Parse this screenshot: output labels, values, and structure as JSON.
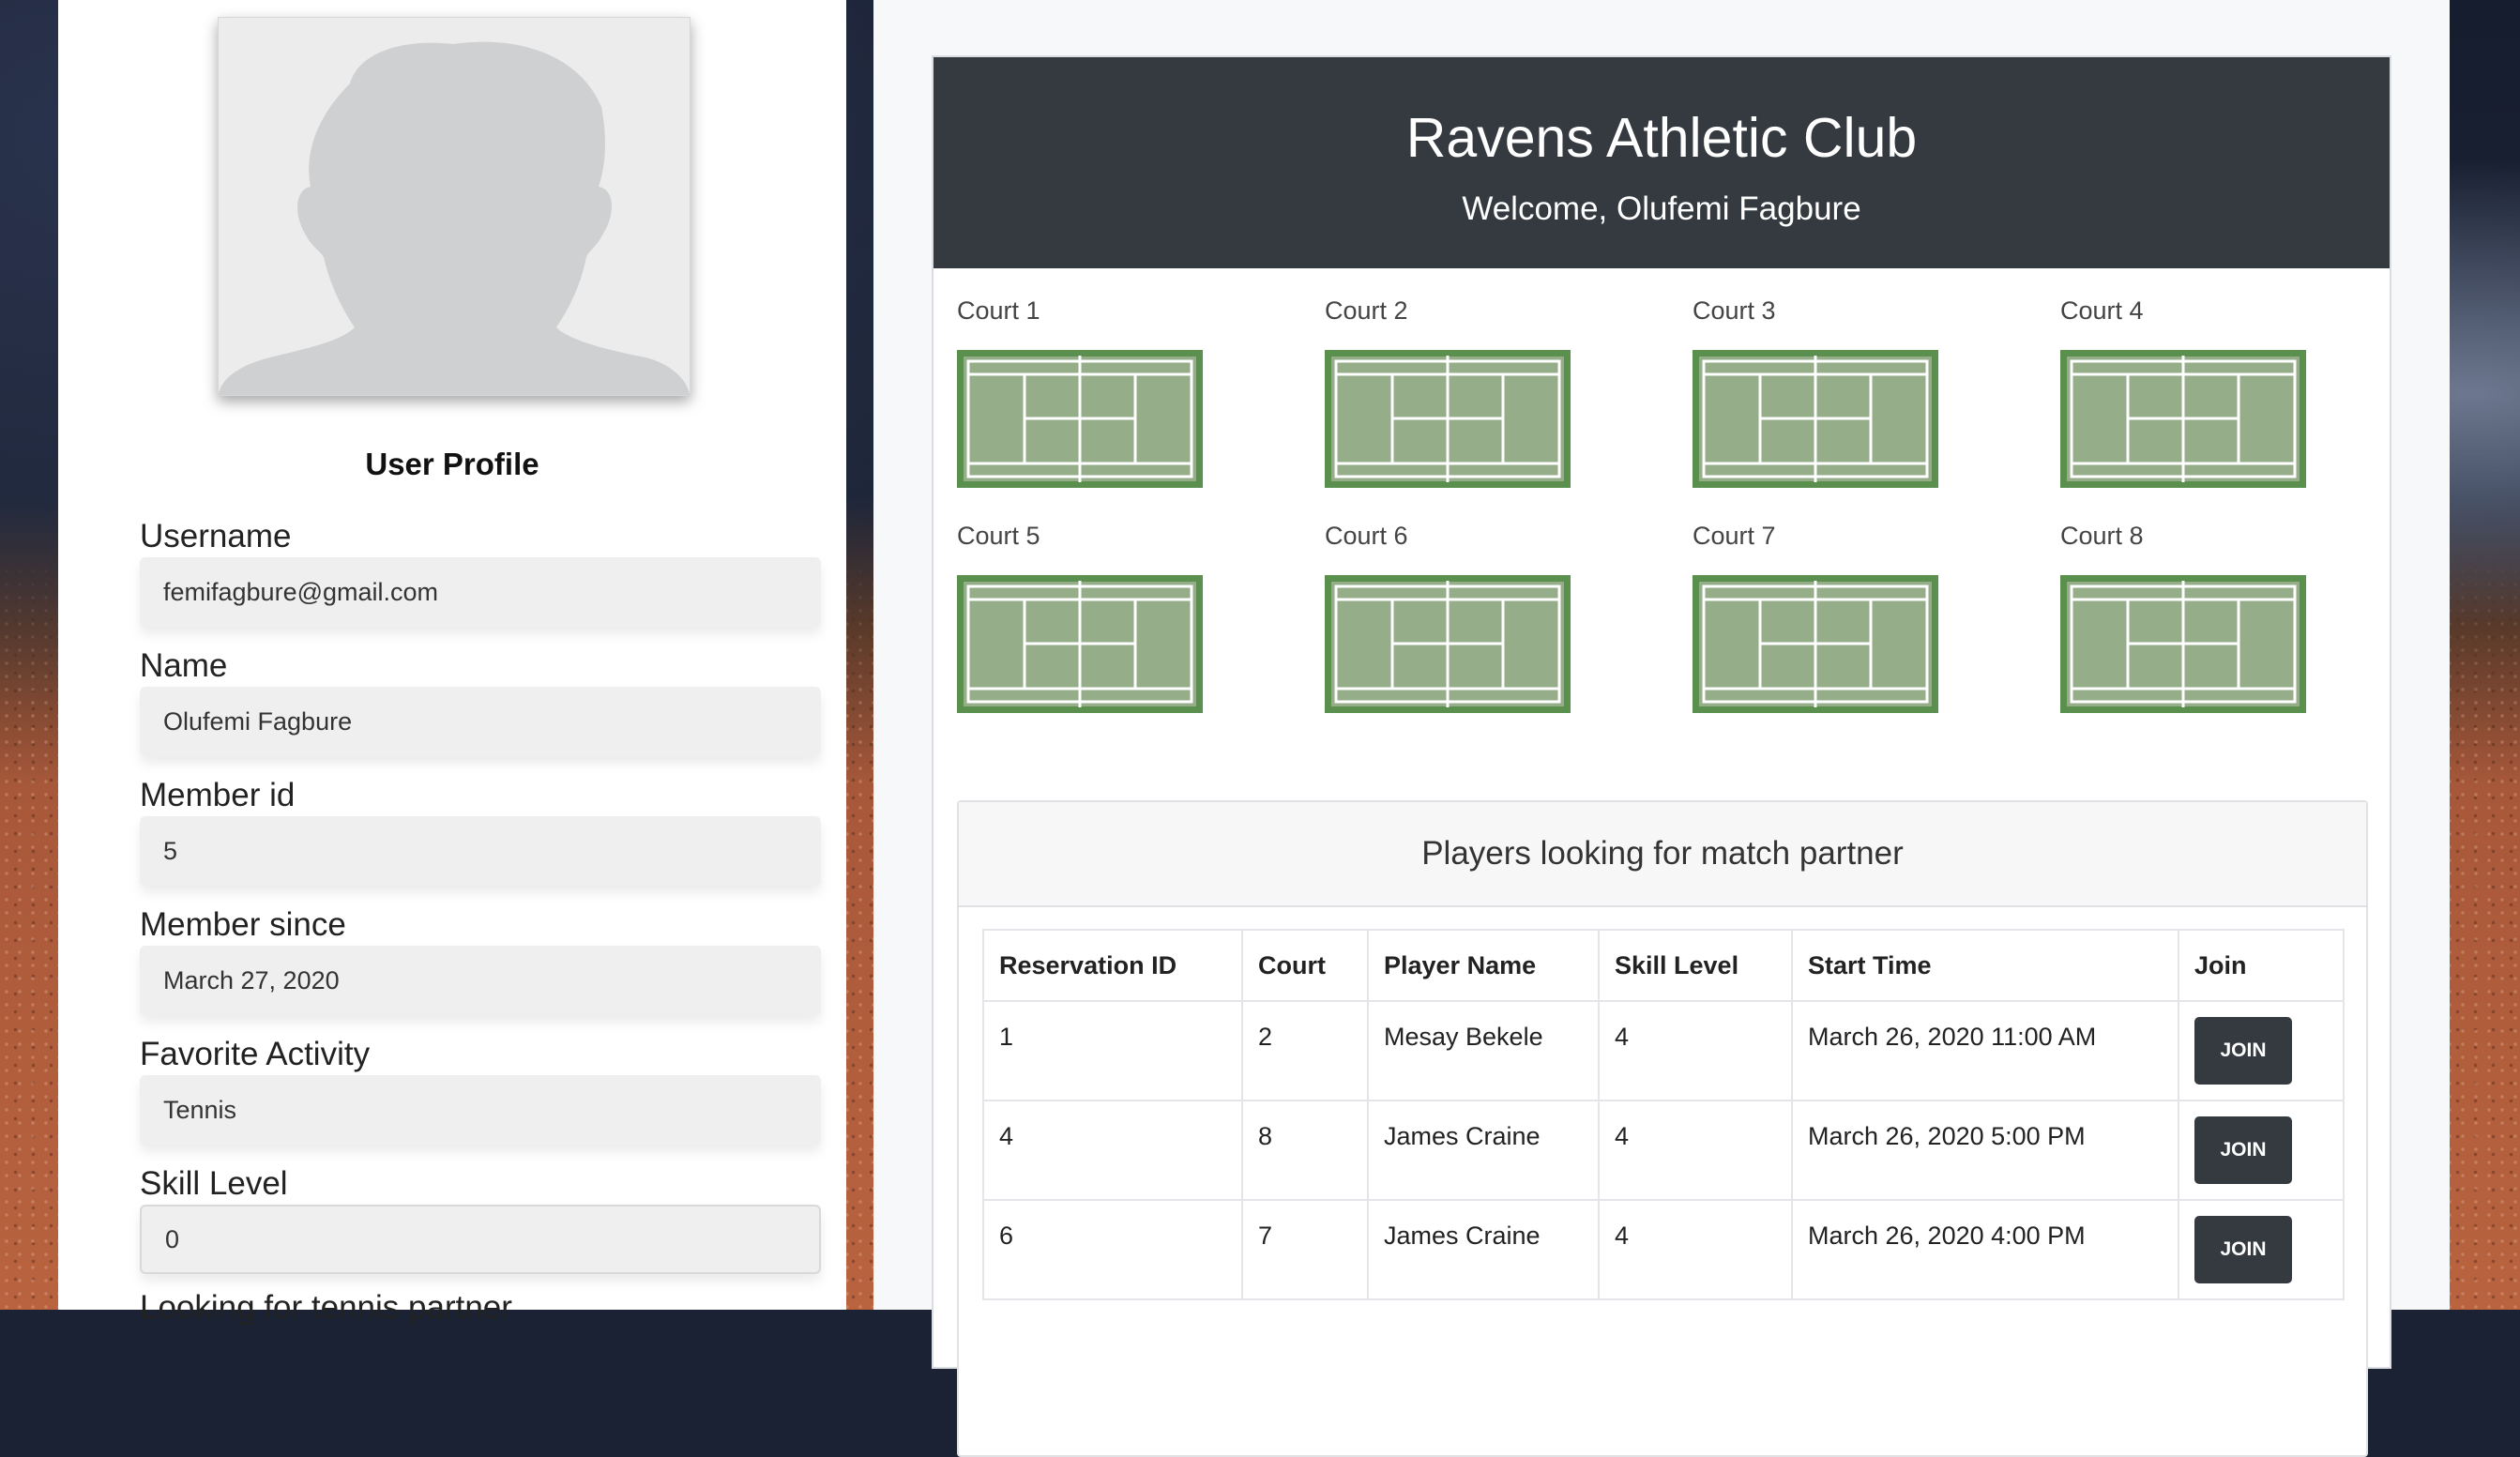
{
  "profile": {
    "title": "User Profile",
    "fields": [
      {
        "label": "Username",
        "value": "femifagbure@gmail.com"
      },
      {
        "label": "Name",
        "value": "Olufemi Fagbure"
      },
      {
        "label": "Member id",
        "value": "5"
      },
      {
        "label": "Member since",
        "value": "March 27, 2020"
      },
      {
        "label": "Favorite Activity",
        "value": "Tennis"
      },
      {
        "label": "Skill Level",
        "value": "0"
      }
    ],
    "next_label": "Looking for tennis partner"
  },
  "club": {
    "title": "Ravens Athletic Club",
    "welcome": "Welcome, Olufemi Fagbure"
  },
  "courts": [
    "Court 1",
    "Court 2",
    "Court 3",
    "Court 4",
    "Court 5",
    "Court 6",
    "Court 7",
    "Court 8"
  ],
  "partners": {
    "heading": "Players looking for match partner",
    "columns": [
      "Reservation ID",
      "Court",
      "Player Name",
      "Skill Level",
      "Start Time",
      "Join"
    ],
    "rows": [
      {
        "id": "1",
        "court": "2",
        "player": "Mesay Bekele",
        "skill": "4",
        "start": "March 26, 2020 11:00 AM",
        "action": "JOIN"
      },
      {
        "id": "4",
        "court": "8",
        "player": "James Craine",
        "skill": "4",
        "start": "March 26, 2020 5:00 PM",
        "action": "JOIN"
      },
      {
        "id": "6",
        "court": "7",
        "player": "James Craine",
        "skill": "4",
        "start": "March 26, 2020 4:00 PM",
        "action": "JOIN"
      }
    ]
  },
  "colors": {
    "header_bg": "#343a40",
    "court_border": "#5a8f4e",
    "court_fill": "#95ad88",
    "button_bg": "#343a40"
  }
}
